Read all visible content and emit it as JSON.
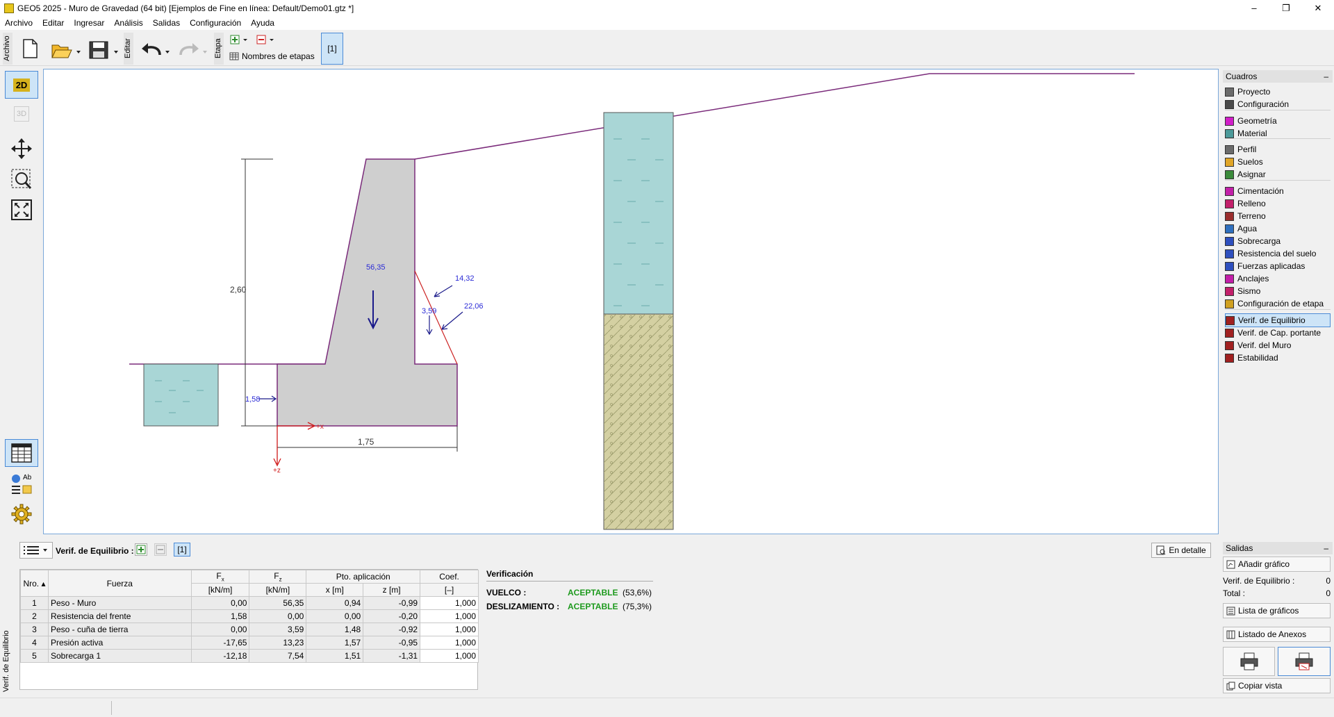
{
  "window": {
    "title": "GEO5 2025 - Muro de Gravedad (64 bit) [Ejemplos de Fine en línea: Default/Demo01.gtz *]",
    "minimize": "–",
    "restore": "❐",
    "close": "✕"
  },
  "menu": [
    "Archivo",
    "Editar",
    "Ingresar",
    "Análisis",
    "Salidas",
    "Configuración",
    "Ayuda"
  ],
  "toolbar": {
    "archivo_label": "Archivo",
    "editar_label": "Editar",
    "etapa_label": "Etapa",
    "stage_names_label": "Nombres de etapas",
    "stage_button": "[1]"
  },
  "left_tools": {
    "view_2d": "2D",
    "view_3d": "3D",
    "ab_label": "Ab"
  },
  "drawing": {
    "dim_height": "2,60",
    "dim_width": "1,75",
    "force_weight": "56,35",
    "force_surcharge": "14,32",
    "force_wedge": "3,59",
    "force_active": "22,06",
    "force_front": "1,58",
    "axis_x": "+x",
    "axis_z": "+z"
  },
  "cuadros": {
    "header": "Cuadros",
    "collapse": "–",
    "items": [
      {
        "label": "Proyecto",
        "icon": "document-icon",
        "color": "#6b6b6b"
      },
      {
        "label": "Configuración",
        "icon": "gear-icon",
        "color": "#4a4a4a"
      },
      {
        "label": "Geometría",
        "icon": "geometry-icon",
        "color": "#d11ec8"
      },
      {
        "label": "Material",
        "icon": "material-icon",
        "color": "#4c9a9a"
      },
      {
        "label": "Perfil",
        "icon": "profile-icon",
        "color": "#6b6b6b"
      },
      {
        "label": "Suelos",
        "icon": "soils-icon",
        "color": "#e0a526"
      },
      {
        "label": "Asignar",
        "icon": "assign-icon",
        "color": "#3b8a3b"
      },
      {
        "label": "Cimentación",
        "icon": "foundation-icon",
        "color": "#c21fa8"
      },
      {
        "label": "Relleno",
        "icon": "backfill-icon",
        "color": "#c21f6a"
      },
      {
        "label": "Terreno",
        "icon": "terrain-icon",
        "color": "#9a2d2d"
      },
      {
        "label": "Agua",
        "icon": "water-icon",
        "color": "#2e6fbe"
      },
      {
        "label": "Sobrecarga",
        "icon": "surcharge-icon",
        "color": "#2e4fbe"
      },
      {
        "label": "Resistencia del suelo",
        "icon": "soil-resistance-icon",
        "color": "#2e4fbe"
      },
      {
        "label": "Fuerzas aplicadas",
        "icon": "applied-forces-icon",
        "color": "#2e4fbe"
      },
      {
        "label": "Anclajes",
        "icon": "anchors-icon",
        "color": "#c21fa8"
      },
      {
        "label": "Sismo",
        "icon": "earthquake-icon",
        "color": "#c21f6a"
      },
      {
        "label": "Configuración de etapa",
        "icon": "stage-settings-icon",
        "color": "#d0a020"
      },
      {
        "label": "Verif. de Equilibrio",
        "icon": "equilibrium-icon",
        "color": "#a02020"
      },
      {
        "label": "Verif. de Cap. portante",
        "icon": "bearing-icon",
        "color": "#a02020"
      },
      {
        "label": "Verif. del Muro",
        "icon": "wall-check-icon",
        "color": "#a02020"
      },
      {
        "label": "Estabilidad",
        "icon": "stability-icon",
        "color": "#a02020"
      }
    ]
  },
  "bottom": {
    "side_label": "Verif. de Equilibrio",
    "section_label": "Verif. de Equilibrio :",
    "stage_tag": "[1]",
    "detail_button": "En detalle",
    "table_headers": {
      "nro": "Nro.",
      "fuerza": "Fuerza",
      "fx": "Fx",
      "fz": "Fz",
      "pto": "Pto. aplicación",
      "coef": "Coef.",
      "fx_unit": "[kN/m]",
      "fz_unit": "[kN/m]",
      "x_unit": "x [m]",
      "z_unit": "z [m]",
      "coef_unit": "[–]"
    },
    "rows": [
      [
        "1",
        "Peso - Muro",
        "0,00",
        "56,35",
        "0,94",
        "-0,99",
        "1,000"
      ],
      [
        "2",
        "Resistencia del frente",
        "1,58",
        "0,00",
        "0,00",
        "-0,20",
        "1,000"
      ],
      [
        "3",
        "Peso - cuña de tierra",
        "0,00",
        "3,59",
        "1,48",
        "-0,92",
        "1,000"
      ],
      [
        "4",
        "Presión activa",
        "-17,65",
        "13,23",
        "1,57",
        "-0,95",
        "1,000"
      ],
      [
        "5",
        "Sobrecarga 1",
        "-12,18",
        "7,54",
        "1,51",
        "-1,31",
        "1,000"
      ]
    ],
    "verification": {
      "title": "Verificación",
      "items": [
        {
          "label": "VUELCO :",
          "status": "ACEPTABLE",
          "pct": "(53,6%)"
        },
        {
          "label": "DESLIZAMIENTO :",
          "status": "ACEPTABLE",
          "pct": "(75,3%)"
        }
      ],
      "ok_color": "#1e9a1e"
    }
  },
  "outputs": {
    "header": "Salidas",
    "collapse": "–",
    "add_graph": "Añadir gráfico",
    "eq_label": "Verif. de Equilibrio :",
    "eq_count": "0",
    "total_label": "Total :",
    "total_count": "0",
    "graph_list": "Lista de gráficos",
    "annex_list": "Listado de Anexos",
    "copy_view": "Copiar vista"
  }
}
